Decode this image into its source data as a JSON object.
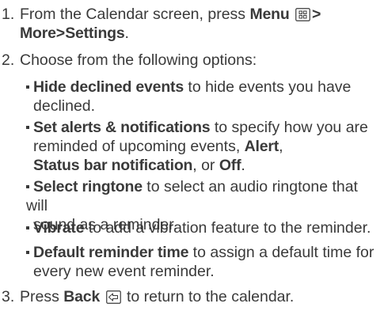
{
  "steps": [
    {
      "number": "1.",
      "parts": {
        "pre": "From the Calendar screen, press",
        "menu_label": "Menu",
        "menu_icon": "menu-key-icon",
        "separator": ">",
        "more_label": "More",
        "settings_label": "Settings",
        "end": "."
      }
    },
    {
      "number": "2.",
      "text": "Choose from the following options:"
    },
    {
      "number": "3.",
      "parts": {
        "pre": "Press",
        "back_label": "Back",
        "back_icon": "back-key-icon",
        "post": "to return to the calendar."
      }
    }
  ],
  "options": [
    {
      "label": "Hide declined events",
      "line1": " to hide events you have",
      "line2": "declined."
    },
    {
      "label": "Set alerts & notifications",
      "line1": " to specify how you are",
      "line2": "reminded of upcoming events, ",
      "alert": "Alert",
      "comma": ",",
      "status": "Status bar notification",
      "or": ", or ",
      "off": "Off",
      "end": "."
    },
    {
      "label": "Select ringtone",
      "line1": " to select an audio ringtone that will",
      "line2": "sound as a reminder."
    },
    {
      "label": "Vibrate",
      "line1": " to add a vibration feature to the reminder."
    },
    {
      "label": "Default reminder time",
      "line1": " to assign a default time for",
      "line2": "every new event reminder."
    }
  ],
  "colors": {
    "text": "#3a3a3a",
    "background": "#ffffff"
  }
}
